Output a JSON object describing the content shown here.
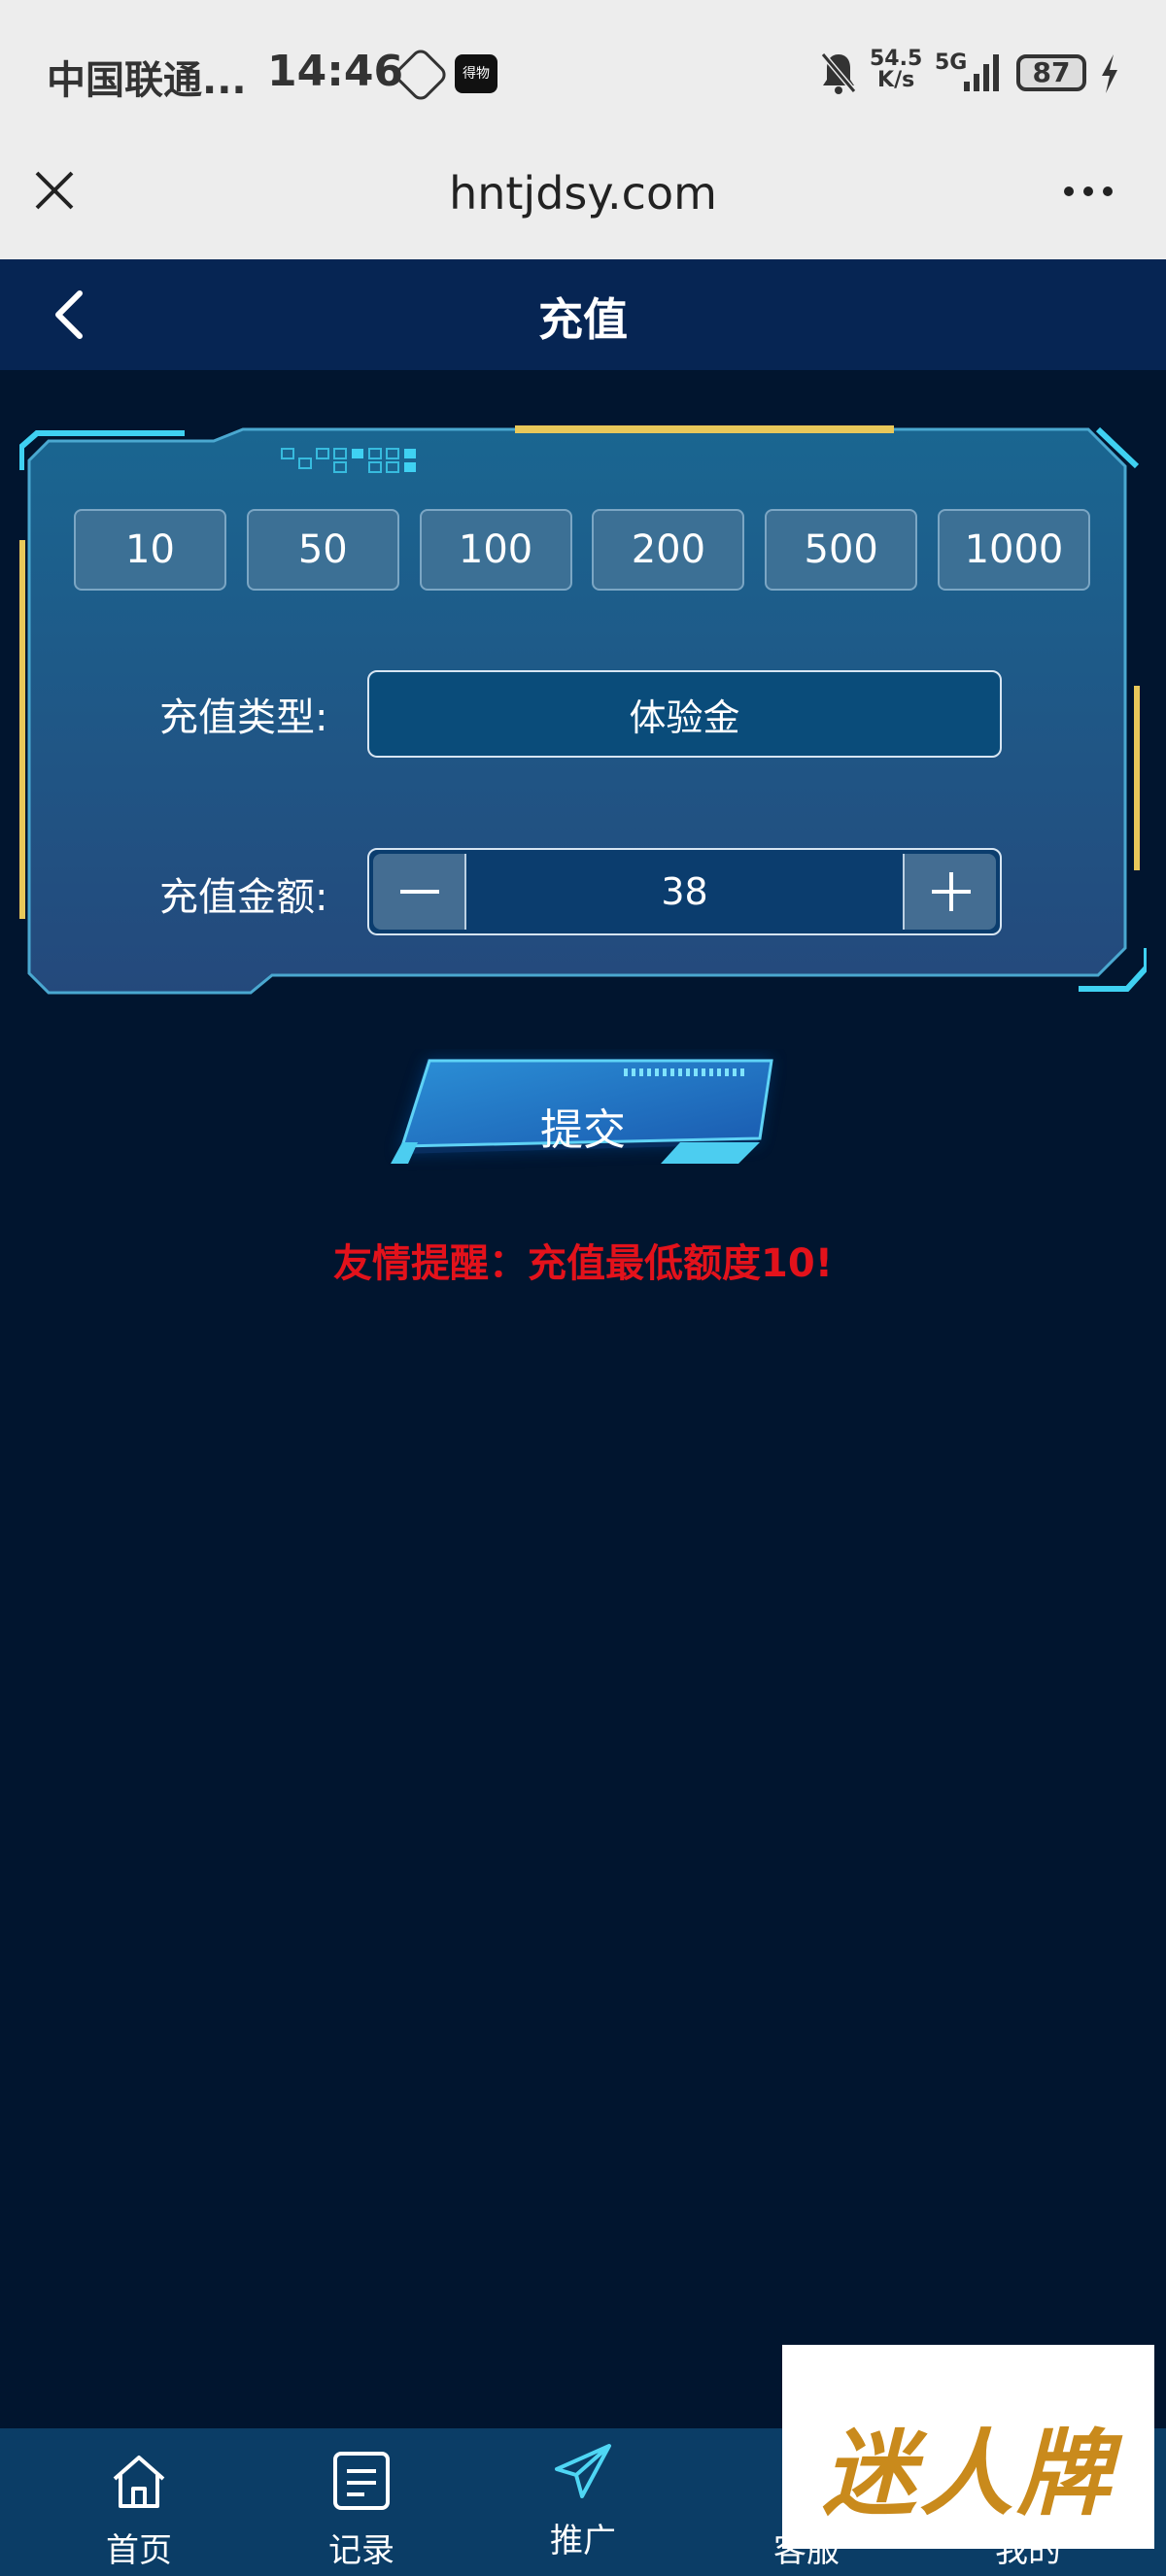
{
  "status_bar": {
    "carrier": "中国联通...",
    "time": "14:46",
    "app_badge": "得物",
    "net_speed_value": "54.5",
    "net_speed_unit": "K/s",
    "network": "5G",
    "battery": "87"
  },
  "browser": {
    "url": "hntjdsy.com"
  },
  "header": {
    "title": "充值"
  },
  "recharge": {
    "amount_options": [
      "10",
      "50",
      "100",
      "200",
      "500",
      "1000"
    ],
    "type_label": "充值类型:",
    "type_value": "体验金",
    "amount_label": "充值金额:",
    "amount_value": "38",
    "submit_label": "提交",
    "reminder": "友情提醒：充值最低额度10!"
  },
  "bottom_nav": {
    "items": [
      {
        "label": "首页",
        "icon": "home-icon"
      },
      {
        "label": "记录",
        "icon": "record-icon"
      },
      {
        "label": "推广",
        "icon": "paper-plane-icon"
      },
      {
        "label": "客服",
        "icon": "customer-service-icon"
      },
      {
        "label": "我的",
        "icon": "user-icon"
      }
    ]
  },
  "watermark": {
    "text": "迷人牌"
  },
  "colors": {
    "background": "#01152f",
    "header": "#062553",
    "panel": "#1d5a88",
    "accent_cyan": "#3fd1f2",
    "accent_yellow": "#e8c85a",
    "reminder": "#e3121b"
  }
}
